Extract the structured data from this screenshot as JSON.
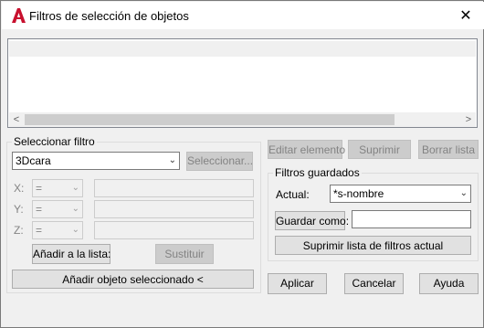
{
  "window": {
    "title": "Filtros de selección de objetos",
    "close_symbol": "✕",
    "accent_color": "#c8102e"
  },
  "list": {
    "left_arrow": "<",
    "right_arrow": ">"
  },
  "select_filter": {
    "group_label": "Seleccionar filtro",
    "type_value": "3Dcara",
    "select_button": "Seleccionar...",
    "x_label": "X:",
    "y_label": "Y:",
    "z_label": "Z:",
    "operator": "=",
    "add_to_list_button": "Añadir a la lista:",
    "replace_button": "Sustituir",
    "add_selected_button": "Añadir objeto seleccionado <"
  },
  "list_actions": {
    "edit_button": "Editar elemento",
    "delete_button": "Suprimir",
    "clear_button": "Borrar lista"
  },
  "saved_filters": {
    "group_label": "Filtros guardados",
    "current_label": "Actual:",
    "current_value": "*s-nombre",
    "save_as_button": "Guardar como:",
    "save_as_value": "",
    "delete_current_button": "Suprimir lista de filtros actual"
  },
  "footer": {
    "apply_button": "Aplicar",
    "cancel_button": "Cancelar",
    "help_button": "Ayuda"
  }
}
